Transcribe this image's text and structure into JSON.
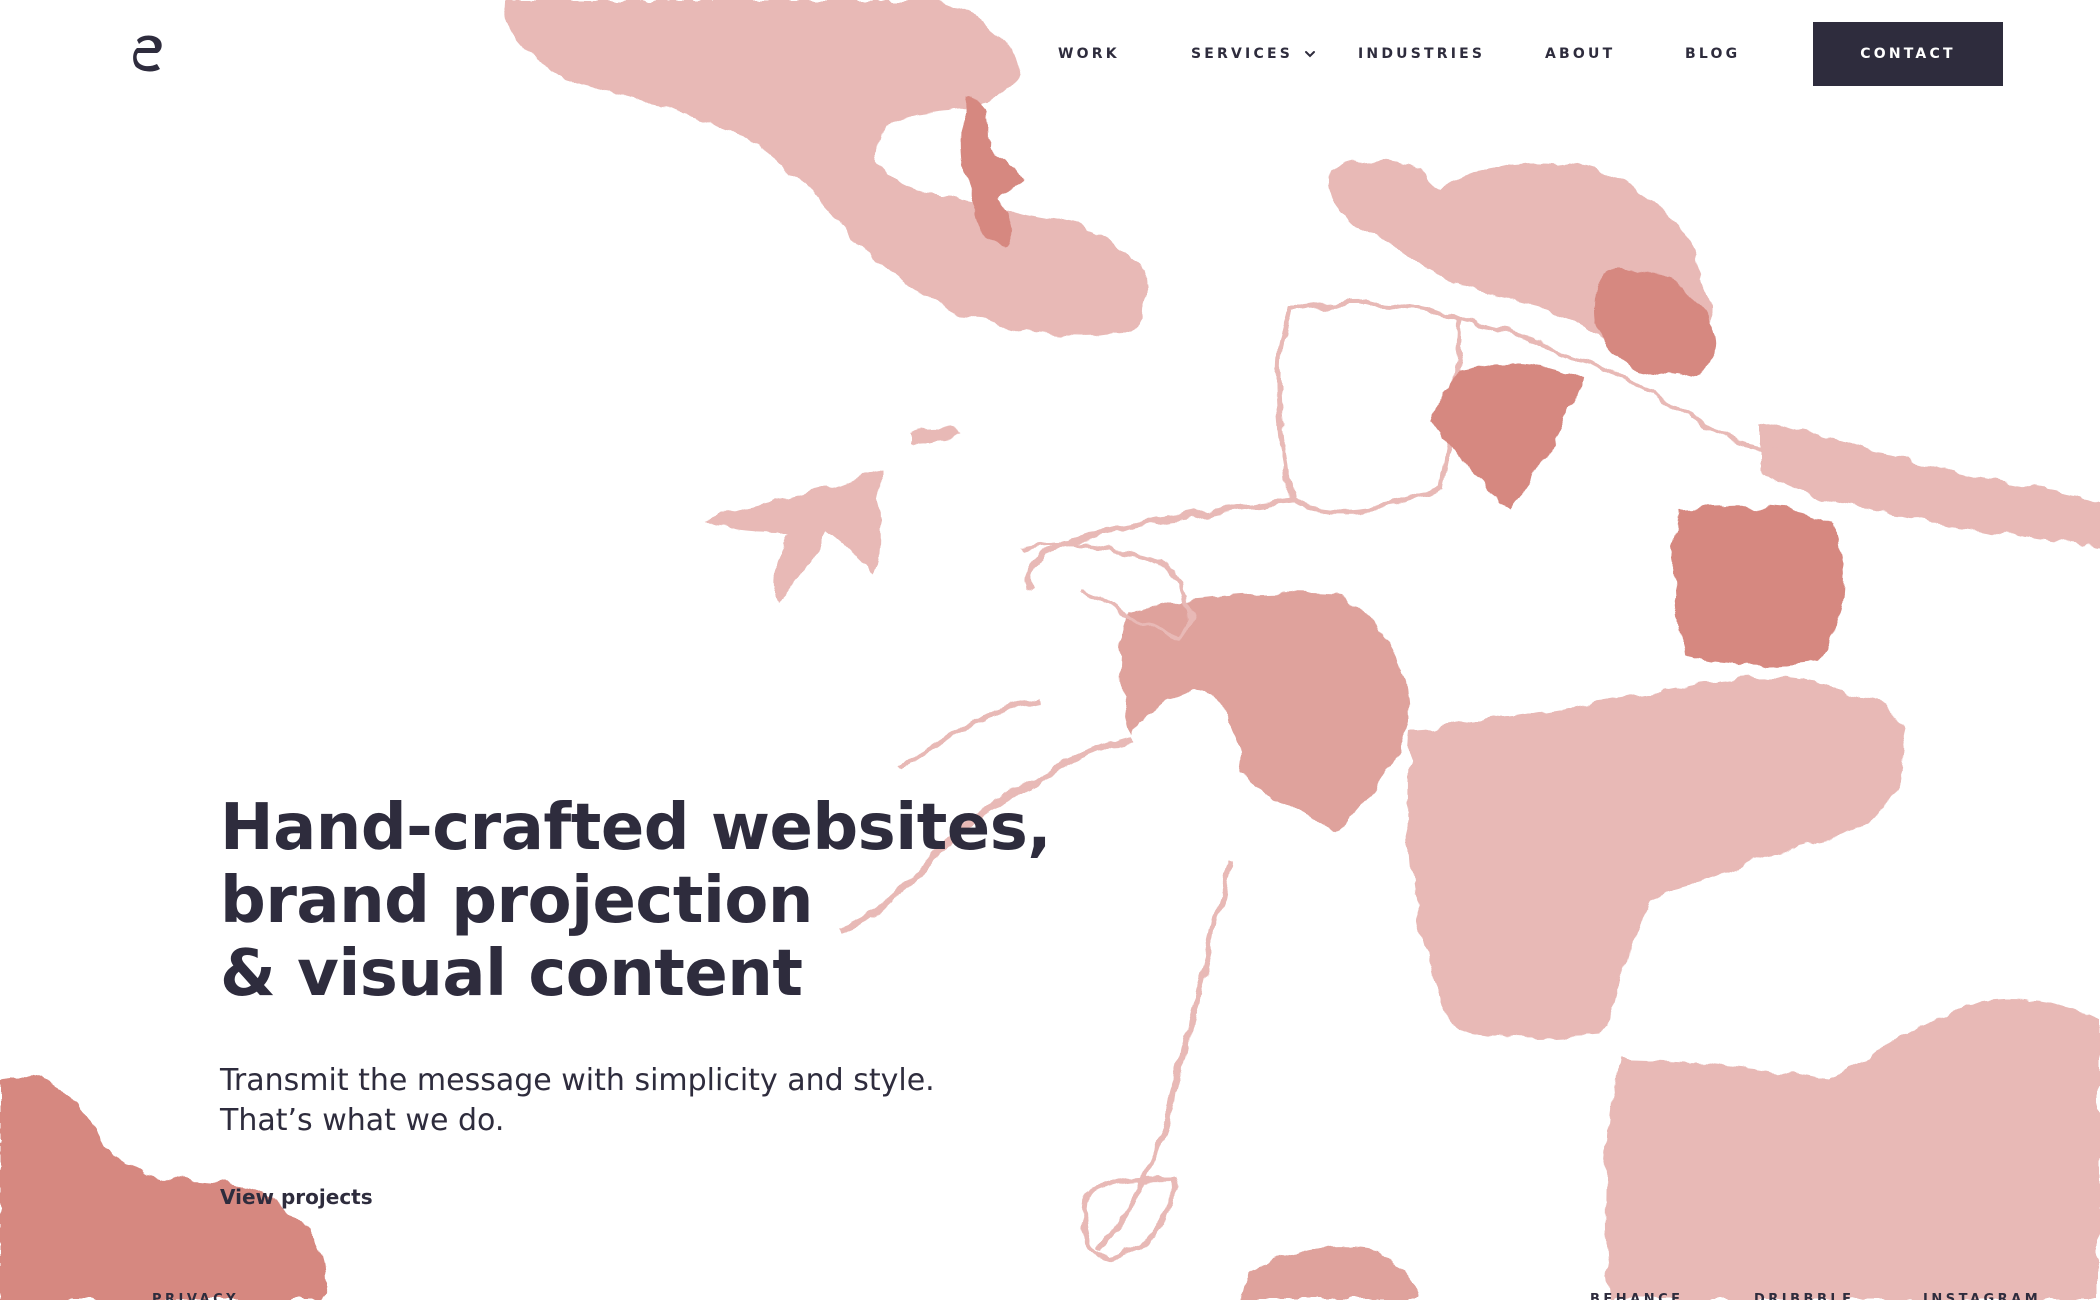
{
  "header": {
    "logo": "logo-icon",
    "nav": {
      "work": "WORK",
      "services": "SERVICES",
      "industries": "INDUSTRIES",
      "about": "ABOUT",
      "blog": "BLOG"
    },
    "contact_label": "CONTACT"
  },
  "hero": {
    "title_lines": [
      "Hand-crafted websites,",
      "brand projection",
      "& visual content"
    ],
    "subtitle_lines": [
      "Transmit the message with simplicity and style.",
      "That’s what we do."
    ],
    "cta_label": "View projects"
  },
  "footer": {
    "privacy": "PRIVACY",
    "behance": "BEHANCE",
    "dribbble": "DRIBBBLE",
    "instagram": "INSTAGRAM"
  },
  "colors": {
    "ink": "#2e2c3d",
    "illustration_light": "#e8b9b6",
    "illustration_mid": "#dfa29c",
    "illustration_dark": "#d68880",
    "background": "#ffffff"
  },
  "icons": {
    "services_chevron": "chevron-down-icon"
  }
}
